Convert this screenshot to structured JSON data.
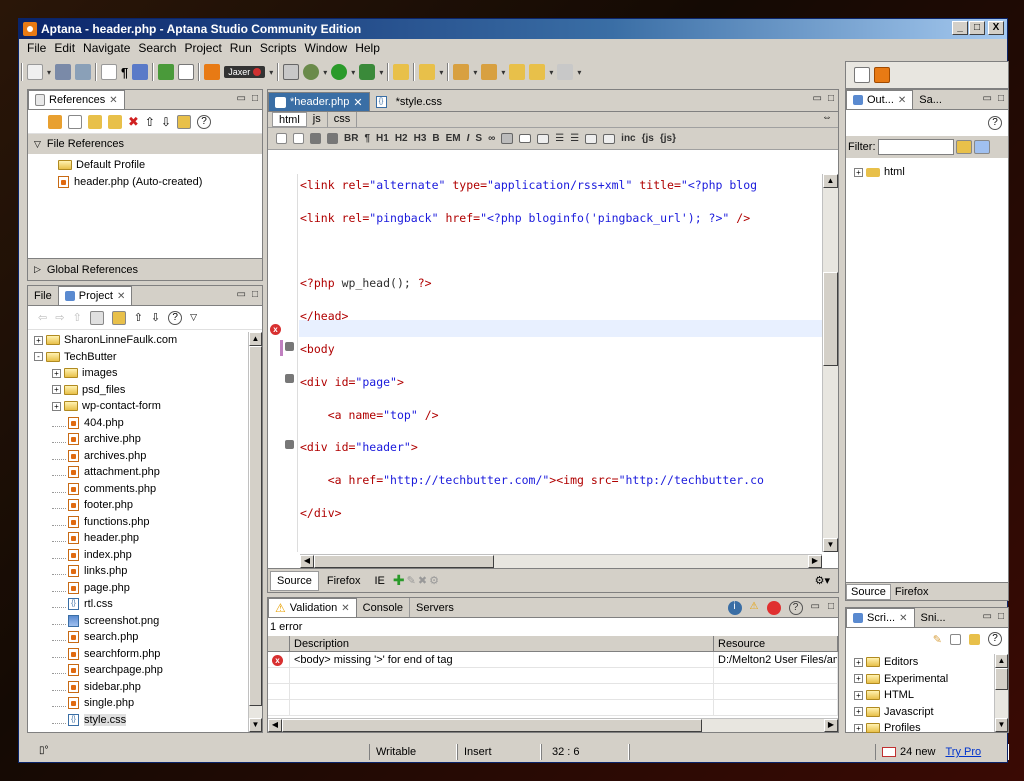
{
  "window": {
    "title": "Aptana - header.php - Aptana Studio Community Edition",
    "minimize": "_",
    "maximize": "□",
    "close": "X"
  },
  "menu": [
    "File",
    "Edit",
    "Navigate",
    "Search",
    "Project",
    "Run",
    "Scripts",
    "Window",
    "Help"
  ],
  "toolbar": {
    "jaxer_label": "Jaxer"
  },
  "references": {
    "tab": "References",
    "file_refs": "File References",
    "items": [
      "Default Profile",
      "header.php (Auto-created)"
    ],
    "global": "Global References"
  },
  "project": {
    "tabs": [
      "File",
      "Project"
    ],
    "tree": [
      {
        "label": "SharonLinneFaulk.com",
        "type": "folder",
        "level": 0,
        "exp": "+"
      },
      {
        "label": "TechButter",
        "type": "folder",
        "level": 0,
        "exp": "-"
      },
      {
        "label": "images",
        "type": "folder",
        "level": 1,
        "exp": "+"
      },
      {
        "label": "psd_files",
        "type": "folder",
        "level": 1,
        "exp": "+"
      },
      {
        "label": "wp-contact-form",
        "type": "folder",
        "level": 1,
        "exp": "+"
      },
      {
        "label": "404.php",
        "type": "php",
        "level": 1
      },
      {
        "label": "archive.php",
        "type": "php",
        "level": 1
      },
      {
        "label": "archives.php",
        "type": "php",
        "level": 1
      },
      {
        "label": "attachment.php",
        "type": "php",
        "level": 1
      },
      {
        "label": "comments.php",
        "type": "php",
        "level": 1
      },
      {
        "label": "footer.php",
        "type": "php",
        "level": 1
      },
      {
        "label": "functions.php",
        "type": "php",
        "level": 1
      },
      {
        "label": "header.php",
        "type": "php",
        "level": 1
      },
      {
        "label": "index.php",
        "type": "php",
        "level": 1
      },
      {
        "label": "links.php",
        "type": "php",
        "level": 1
      },
      {
        "label": "page.php",
        "type": "php",
        "level": 1
      },
      {
        "label": "rtl.css",
        "type": "css",
        "level": 1
      },
      {
        "label": "screenshot.png",
        "type": "png",
        "level": 1
      },
      {
        "label": "search.php",
        "type": "php",
        "level": 1
      },
      {
        "label": "searchform.php",
        "type": "php",
        "level": 1
      },
      {
        "label": "searchpage.php",
        "type": "php",
        "level": 1
      },
      {
        "label": "sidebar.php",
        "type": "php",
        "level": 1
      },
      {
        "label": "single.php",
        "type": "php",
        "level": 1
      },
      {
        "label": "style.css",
        "type": "css",
        "level": 1
      }
    ]
  },
  "editor": {
    "tabs": [
      "*header.php",
      "*style.css"
    ],
    "subtabs": [
      "html",
      "js",
      "css"
    ],
    "format_buttons": [
      "BR",
      "¶",
      "H1",
      "H2",
      "H3",
      "B",
      "EM",
      "I",
      "S"
    ],
    "bottom_tabs": [
      "Source",
      "Firefox",
      "IE"
    ],
    "lines": [
      {
        "y": 0,
        "html": "<span class='tg'>&lt;link</span> <span class='at'>rel=</span><span class='vl'>\"alternate\"</span> <span class='at'>type=</span><span class='vl'>\"application/rss+xml\"</span> <span class='at'>title=</span><span class='vl'>\"&lt;?php blog</span>"
      },
      {
        "y": 1,
        "html": "<span class='tg'>&lt;link</span> <span class='at'>rel=</span><span class='vl'>\"pingback\"</span> <span class='at'>href=</span><span class='vl'>\"&lt;?php bloginfo('pingback_url'); ?&gt;\"</span> <span class='tg'>/&gt;</span>"
      },
      {
        "y": 3,
        "html": "<span class='tg'>&lt;?php</span> <span class='ph'>wp_head();</span> <span class='tg'>?&gt;</span>"
      },
      {
        "y": 4,
        "html": "<span class='tg'>&lt;/head&gt;</span>"
      },
      {
        "y": 5,
        "html": "<span class='tg'>&lt;body</span>"
      },
      {
        "y": 6,
        "html": "<span class='tg'>&lt;div</span> <span class='at'>id=</span><span class='vl'>\"page\"</span><span class='tg'>&gt;</span>"
      },
      {
        "y": 7,
        "html": "    <span class='tg'>&lt;a</span> <span class='at'>name=</span><span class='vl'>\"top\"</span> <span class='tg'>/&gt;</span>"
      },
      {
        "y": 8,
        "html": "<span class='tg'>&lt;div</span> <span class='at'>id=</span><span class='vl'>\"header\"</span><span class='tg'>&gt;</span>"
      },
      {
        "y": 9,
        "html": "    <span class='tg'>&lt;a</span> <span class='at'>href=</span><span class='vl'>\"http://techbutter.com/\"</span><span class='tg'>&gt;&lt;img</span> <span class='at'>src=</span><span class='vl'>\"http://techbutter.co</span>"
      },
      {
        "y": 10,
        "html": "<span class='tg'>&lt;/div&gt;</span>"
      }
    ]
  },
  "outline": {
    "tabs": [
      "Out...",
      "Sa..."
    ],
    "filter_label": "Filter:",
    "root": "html",
    "bottom_tabs": [
      "Source",
      "Firefox"
    ]
  },
  "scripts": {
    "tabs": [
      "Scri...",
      "Sni..."
    ],
    "items": [
      "Editors",
      "Experimental",
      "HTML",
      "Javascript",
      "Profiles"
    ]
  },
  "validation": {
    "tabs": [
      "Validation",
      "Console",
      "Servers"
    ],
    "summary": "1 error",
    "cols": [
      "Description",
      "Resource"
    ],
    "rows": [
      {
        "desc": "<body> missing '>' for end of tag",
        "res": "D:/Melton2 User Files/am"
      }
    ]
  },
  "status": {
    "mode": "Writable",
    "insert": "Insert",
    "pos": "32 : 6",
    "mail": "24 new",
    "trypro": "Try Pro"
  }
}
